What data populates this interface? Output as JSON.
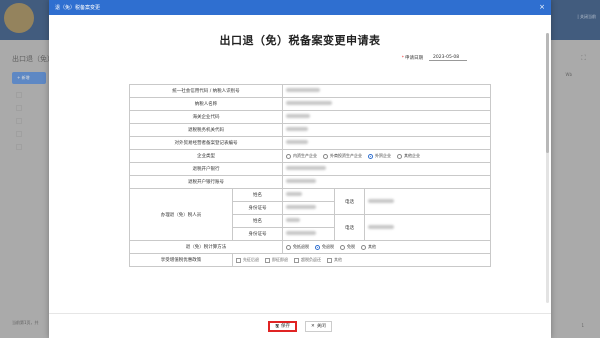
{
  "background": {
    "page_title": "出口退（免）",
    "add_button": "+ 新增",
    "right_text": "Wb",
    "header_right": "| 关闭当前",
    "footer_left": "当前第1页，共",
    "footer_right": "1"
  },
  "modal": {
    "header_title": "退（免）税备案变更",
    "close_symbol": "×",
    "title": "出口退（免）税备案变更申请表",
    "date_label": "申请日期",
    "date_value": "2023-05-08",
    "rows": {
      "taxpayer_id": "统一社会信用代码 / 纳税人识别号",
      "taxpayer_name": "纳税人名称",
      "customs_code": "海关企业代码",
      "tax_authority": "退税税务机关代码",
      "foreign_trade_reg": "对外贸易经营者备案登记表编号",
      "enterprise_type": "企业类型",
      "bank": "退税开户银行",
      "bank_account": "退税开户银行账号",
      "handler_group": "办理退（免）税人员",
      "name": "姓名",
      "id_no": "身份证号",
      "phone": "电话",
      "calc_method": "退（免）税计算方法",
      "incentive": "享受增值税优惠政策"
    },
    "enterprise_types": [
      "内资生产企业",
      "外商投资生产企业",
      "外贸企业",
      "其他企业"
    ],
    "enterprise_selected": 2,
    "calc_methods": [
      "免抵退税",
      "免退税",
      "免税",
      "其他"
    ],
    "calc_selected": 1,
    "incentives": [
      "先征后退",
      "即征即退",
      "超税负返还",
      "其他"
    ],
    "save_label": "保存",
    "close_label": "关闭"
  }
}
